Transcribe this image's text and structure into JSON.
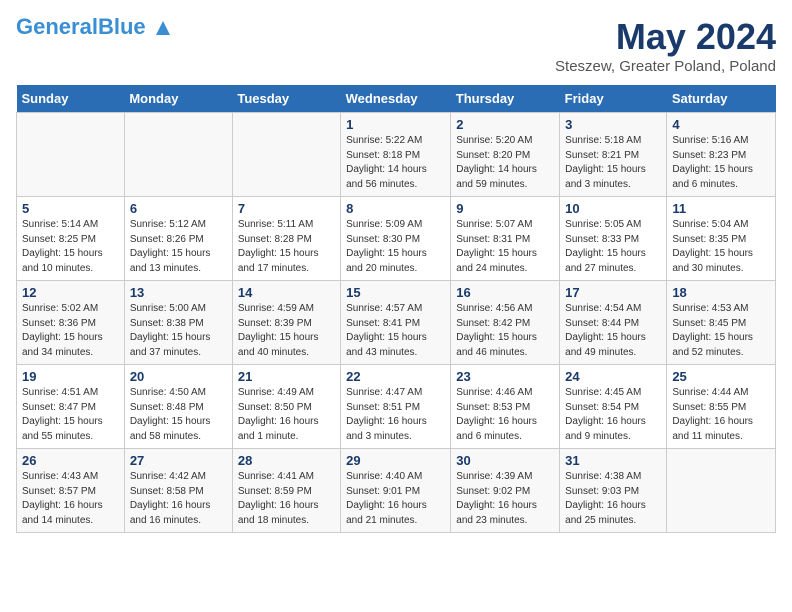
{
  "header": {
    "logo_line1": "General",
    "logo_highlight": "Blue",
    "month_title": "May 2024",
    "location": "Steszew, Greater Poland, Poland"
  },
  "weekdays": [
    "Sunday",
    "Monday",
    "Tuesday",
    "Wednesday",
    "Thursday",
    "Friday",
    "Saturday"
  ],
  "weeks": [
    [
      {
        "day": "",
        "info": ""
      },
      {
        "day": "",
        "info": ""
      },
      {
        "day": "",
        "info": ""
      },
      {
        "day": "1",
        "info": "Sunrise: 5:22 AM\nSunset: 8:18 PM\nDaylight: 14 hours and 56 minutes."
      },
      {
        "day": "2",
        "info": "Sunrise: 5:20 AM\nSunset: 8:20 PM\nDaylight: 14 hours and 59 minutes."
      },
      {
        "day": "3",
        "info": "Sunrise: 5:18 AM\nSunset: 8:21 PM\nDaylight: 15 hours and 3 minutes."
      },
      {
        "day": "4",
        "info": "Sunrise: 5:16 AM\nSunset: 8:23 PM\nDaylight: 15 hours and 6 minutes."
      }
    ],
    [
      {
        "day": "5",
        "info": "Sunrise: 5:14 AM\nSunset: 8:25 PM\nDaylight: 15 hours and 10 minutes."
      },
      {
        "day": "6",
        "info": "Sunrise: 5:12 AM\nSunset: 8:26 PM\nDaylight: 15 hours and 13 minutes."
      },
      {
        "day": "7",
        "info": "Sunrise: 5:11 AM\nSunset: 8:28 PM\nDaylight: 15 hours and 17 minutes."
      },
      {
        "day": "8",
        "info": "Sunrise: 5:09 AM\nSunset: 8:30 PM\nDaylight: 15 hours and 20 minutes."
      },
      {
        "day": "9",
        "info": "Sunrise: 5:07 AM\nSunset: 8:31 PM\nDaylight: 15 hours and 24 minutes."
      },
      {
        "day": "10",
        "info": "Sunrise: 5:05 AM\nSunset: 8:33 PM\nDaylight: 15 hours and 27 minutes."
      },
      {
        "day": "11",
        "info": "Sunrise: 5:04 AM\nSunset: 8:35 PM\nDaylight: 15 hours and 30 minutes."
      }
    ],
    [
      {
        "day": "12",
        "info": "Sunrise: 5:02 AM\nSunset: 8:36 PM\nDaylight: 15 hours and 34 minutes."
      },
      {
        "day": "13",
        "info": "Sunrise: 5:00 AM\nSunset: 8:38 PM\nDaylight: 15 hours and 37 minutes."
      },
      {
        "day": "14",
        "info": "Sunrise: 4:59 AM\nSunset: 8:39 PM\nDaylight: 15 hours and 40 minutes."
      },
      {
        "day": "15",
        "info": "Sunrise: 4:57 AM\nSunset: 8:41 PM\nDaylight: 15 hours and 43 minutes."
      },
      {
        "day": "16",
        "info": "Sunrise: 4:56 AM\nSunset: 8:42 PM\nDaylight: 15 hours and 46 minutes."
      },
      {
        "day": "17",
        "info": "Sunrise: 4:54 AM\nSunset: 8:44 PM\nDaylight: 15 hours and 49 minutes."
      },
      {
        "day": "18",
        "info": "Sunrise: 4:53 AM\nSunset: 8:45 PM\nDaylight: 15 hours and 52 minutes."
      }
    ],
    [
      {
        "day": "19",
        "info": "Sunrise: 4:51 AM\nSunset: 8:47 PM\nDaylight: 15 hours and 55 minutes."
      },
      {
        "day": "20",
        "info": "Sunrise: 4:50 AM\nSunset: 8:48 PM\nDaylight: 15 hours and 58 minutes."
      },
      {
        "day": "21",
        "info": "Sunrise: 4:49 AM\nSunset: 8:50 PM\nDaylight: 16 hours and 1 minute."
      },
      {
        "day": "22",
        "info": "Sunrise: 4:47 AM\nSunset: 8:51 PM\nDaylight: 16 hours and 3 minutes."
      },
      {
        "day": "23",
        "info": "Sunrise: 4:46 AM\nSunset: 8:53 PM\nDaylight: 16 hours and 6 minutes."
      },
      {
        "day": "24",
        "info": "Sunrise: 4:45 AM\nSunset: 8:54 PM\nDaylight: 16 hours and 9 minutes."
      },
      {
        "day": "25",
        "info": "Sunrise: 4:44 AM\nSunset: 8:55 PM\nDaylight: 16 hours and 11 minutes."
      }
    ],
    [
      {
        "day": "26",
        "info": "Sunrise: 4:43 AM\nSunset: 8:57 PM\nDaylight: 16 hours and 14 minutes."
      },
      {
        "day": "27",
        "info": "Sunrise: 4:42 AM\nSunset: 8:58 PM\nDaylight: 16 hours and 16 minutes."
      },
      {
        "day": "28",
        "info": "Sunrise: 4:41 AM\nSunset: 8:59 PM\nDaylight: 16 hours and 18 minutes."
      },
      {
        "day": "29",
        "info": "Sunrise: 4:40 AM\nSunset: 9:01 PM\nDaylight: 16 hours and 21 minutes."
      },
      {
        "day": "30",
        "info": "Sunrise: 4:39 AM\nSunset: 9:02 PM\nDaylight: 16 hours and 23 minutes."
      },
      {
        "day": "31",
        "info": "Sunrise: 4:38 AM\nSunset: 9:03 PM\nDaylight: 16 hours and 25 minutes."
      },
      {
        "day": "",
        "info": ""
      }
    ]
  ]
}
